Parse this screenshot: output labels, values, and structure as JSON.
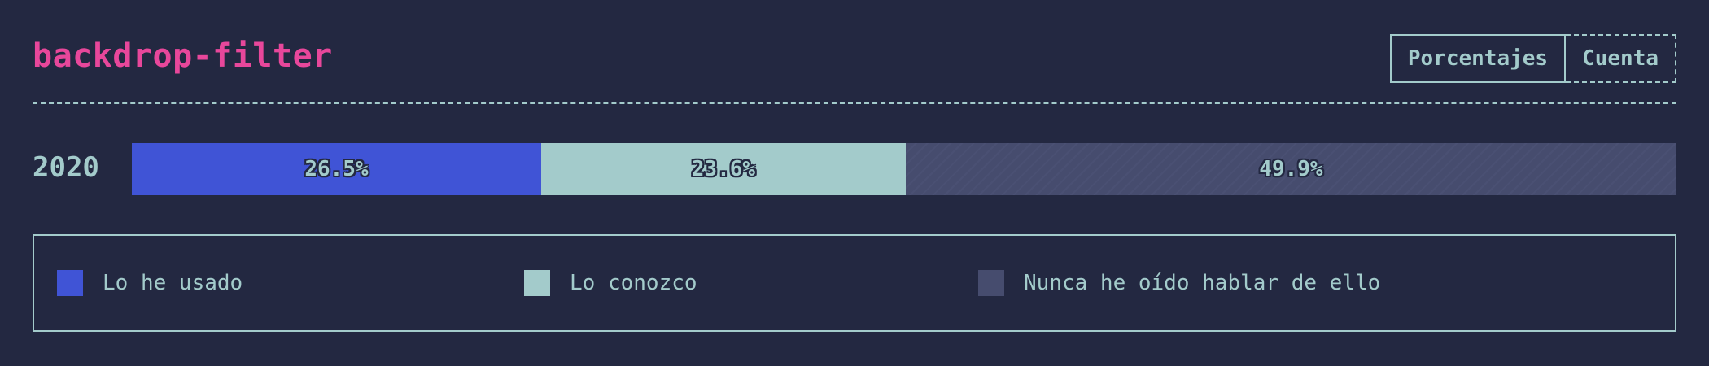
{
  "chart_title": "backdrop-filter",
  "mode_buttons": {
    "percentages": "Porcentajes",
    "count": "Cuenta"
  },
  "colors": {
    "background": "#232841",
    "title": "#e8479b",
    "text": "#a3cbcb",
    "used": "#4054d6",
    "heard": "#a3cbcb",
    "never": "#464c6e"
  },
  "chart_data": {
    "type": "bar",
    "orientation": "horizontal-stacked-100",
    "title": "backdrop-filter",
    "categories": [
      "2020"
    ],
    "series": [
      {
        "name": "Lo he usado",
        "values": [
          26.5
        ],
        "label": "26.5%"
      },
      {
        "name": "Lo conozco",
        "values": [
          23.6
        ],
        "label": "23.6%"
      },
      {
        "name": "Nunca he oído hablar de ello",
        "values": [
          49.9
        ],
        "label": "49.9%"
      }
    ],
    "xlim": [
      0,
      100
    ],
    "unit": "%",
    "grid": false,
    "legend_position": "bottom"
  },
  "legend": [
    {
      "label": "Lo he usado",
      "color": "#4054d6"
    },
    {
      "label": "Lo conozco",
      "color": "#a3cbcb"
    },
    {
      "label": "Nunca he oído hablar de ello",
      "color": "#464c6e"
    }
  ]
}
